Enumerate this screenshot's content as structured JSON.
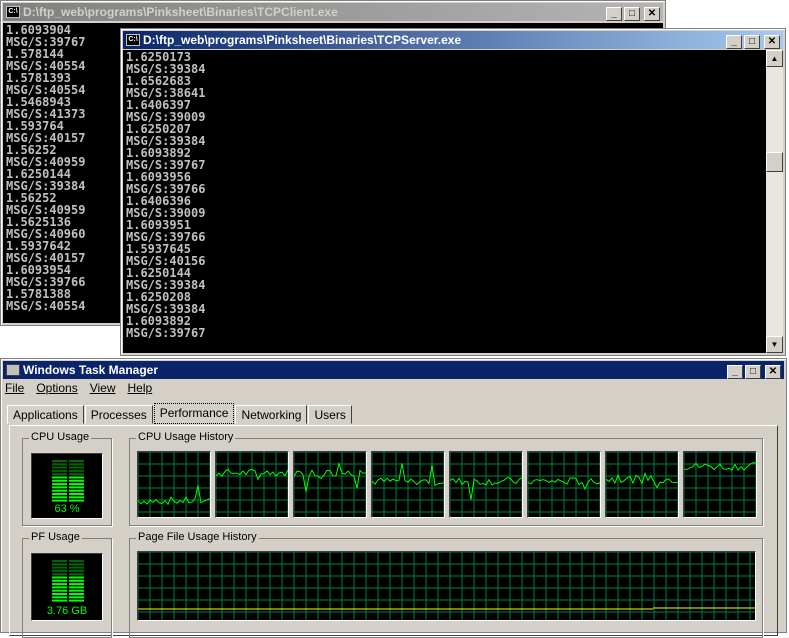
{
  "client": {
    "title": "D:\\ftp_web\\programs\\Pinksheet\\Binaries\\TCPClient.exe",
    "icon": "console-icon",
    "lines": [
      "1.6093904",
      "MSG/S:39767",
      "1.578144",
      "MSG/S:40554",
      "1.5781393",
      "MSG/S:40554",
      "1.5468943",
      "MSG/S:41373",
      "1.593764",
      "MSG/S:40157",
      "1.56252",
      "MSG/S:40959",
      "1.6250144",
      "MSG/S:39384",
      "1.56252",
      "MSG/S:40959",
      "1.5625136",
      "MSG/S:40960",
      "1.5937642",
      "MSG/S:40157",
      "1.6093954",
      "MSG/S:39766",
      "1.5781388",
      "MSG/S:40554"
    ]
  },
  "server": {
    "title": "D:\\ftp_web\\programs\\Pinksheet\\Binaries\\TCPServer.exe",
    "icon": "console-icon",
    "lines": [
      "1.6250173",
      "MSG/S:39384",
      "1.6562683",
      "MSG/S:38641",
      "1.6406397",
      "MSG/S:39009",
      "1.6250207",
      "MSG/S:39384",
      "1.6093892",
      "MSG/S:39767",
      "1.6093956",
      "MSG/S:39766",
      "1.6406396",
      "MSG/S:39009",
      "1.6093951",
      "MSG/S:39766",
      "1.5937645",
      "MSG/S:40156",
      "1.6250144",
      "MSG/S:39384",
      "1.6250208",
      "MSG/S:39384",
      "1.6093892",
      "MSG/S:39767"
    ],
    "scroll_position": 0.4
  },
  "window_buttons": {
    "min": "_",
    "max": "□",
    "close": "✕"
  },
  "taskmgr": {
    "title": "Windows Task Manager",
    "menu": [
      "File",
      "Options",
      "View",
      "Help"
    ],
    "tabs": [
      "Applications",
      "Processes",
      "Performance",
      "Networking",
      "Users"
    ],
    "selected_tab": "Performance",
    "cpu_usage": {
      "label": "CPU Usage",
      "value": "63 %",
      "percent": 63
    },
    "cpu_history": {
      "label": "CPU Usage History",
      "cores": 8
    },
    "pf_usage": {
      "label": "PF Usage",
      "value": "3.76 GB"
    },
    "pf_history": {
      "label": "Page File Usage History"
    },
    "colors": {
      "graph_line": "#00ff00",
      "grid": "#008040",
      "titlebar": "#0a246a"
    }
  }
}
